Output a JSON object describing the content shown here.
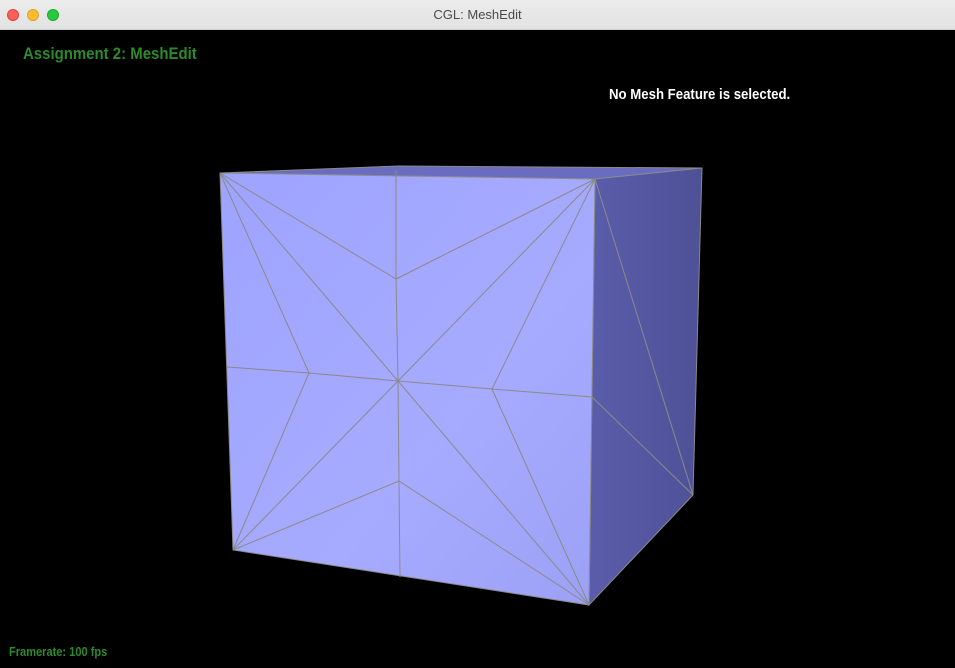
{
  "window": {
    "title": "CGL: MeshEdit"
  },
  "hud": {
    "assignment_title": "Assignment 2: MeshEdit",
    "selection_status": "No Mesh Feature is selected.",
    "framerate": "Framerate: 100 fps"
  },
  "colors": {
    "background": "#000000",
    "hud_green": "#2d8a2d",
    "front_face": "#a2a6ff",
    "side_face": "#5558a3",
    "top_face": "#6a6cc0",
    "edge": "#8a8a8a"
  }
}
